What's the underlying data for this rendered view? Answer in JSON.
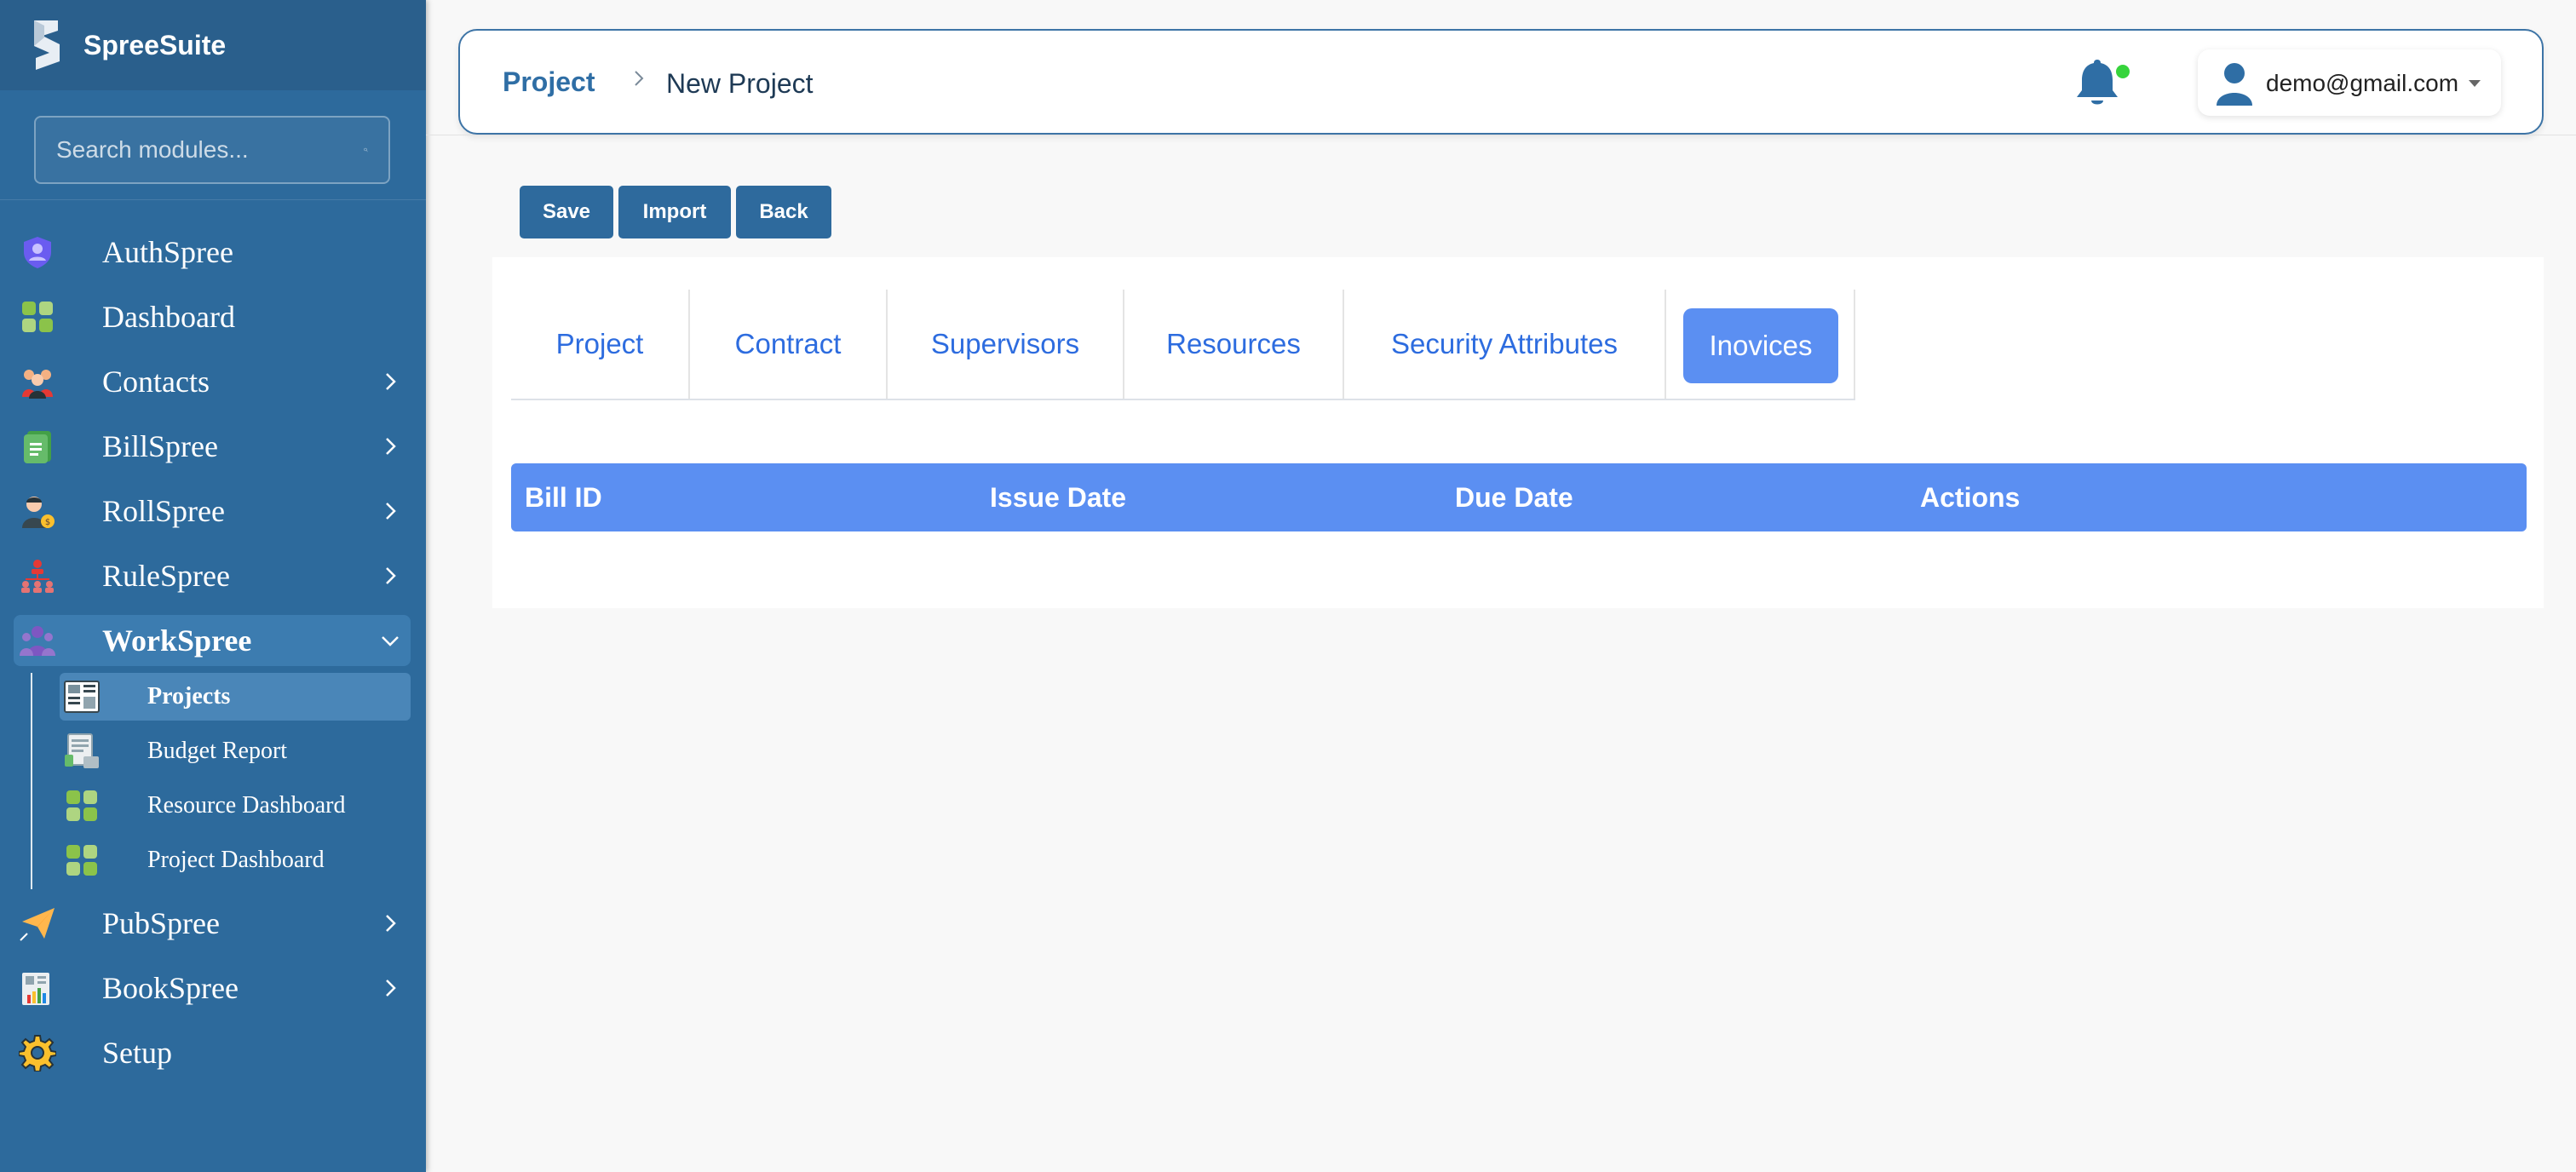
{
  "brand": {
    "name": "SpreeSuite"
  },
  "search": {
    "placeholder": "Search modules..."
  },
  "sidebar": {
    "items": [
      {
        "label": "AuthSpree",
        "icon": "shield-user-icon",
        "has_children": false
      },
      {
        "label": "Dashboard",
        "icon": "dashboard-icon",
        "has_children": false
      },
      {
        "label": "Contacts",
        "icon": "contacts-icon",
        "has_children": true
      },
      {
        "label": "BillSpree",
        "icon": "bill-icon",
        "has_children": true
      },
      {
        "label": "RollSpree",
        "icon": "payroll-icon",
        "has_children": true
      },
      {
        "label": "RuleSpree",
        "icon": "org-chart-icon",
        "has_children": true
      },
      {
        "label": "WorkSpree",
        "icon": "team-icon",
        "has_children": true,
        "expanded": true
      },
      {
        "label": "PubSpree",
        "icon": "paper-plane-icon",
        "has_children": true
      },
      {
        "label": "BookSpree",
        "icon": "ledger-chart-icon",
        "has_children": true
      },
      {
        "label": "Setup",
        "icon": "gear-icon",
        "has_children": false
      }
    ],
    "workspree_children": [
      {
        "label": "Projects",
        "icon": "project-board-icon",
        "active": true
      },
      {
        "label": "Budget Report",
        "icon": "budget-report-icon",
        "active": false
      },
      {
        "label": "Resource Dashboard",
        "icon": "dashboard-icon",
        "active": false
      },
      {
        "label": "Project Dashboard",
        "icon": "dashboard-icon",
        "active": false
      }
    ]
  },
  "header": {
    "breadcrumb_root": "Project",
    "breadcrumb_current": "New Project",
    "user_email": "demo@gmail.com"
  },
  "toolbar": {
    "save_label": "Save",
    "import_label": "Import",
    "back_label": "Back"
  },
  "tabs": [
    {
      "label": "Project",
      "active": false
    },
    {
      "label": "Contract",
      "active": false
    },
    {
      "label": "Supervisors",
      "active": false
    },
    {
      "label": "Resources",
      "active": false
    },
    {
      "label": "Security Attributes",
      "active": false
    },
    {
      "label": "Inovices",
      "active": true
    }
  ],
  "invoices_table": {
    "columns": [
      "Bill ID",
      "Issue Date",
      "Due Date",
      "Actions"
    ],
    "rows": []
  },
  "colors": {
    "sidebar": "#2d6a9c",
    "accent": "#5b8ff2",
    "button": "#2e6a9d",
    "notification_dot": "#36d43c"
  }
}
